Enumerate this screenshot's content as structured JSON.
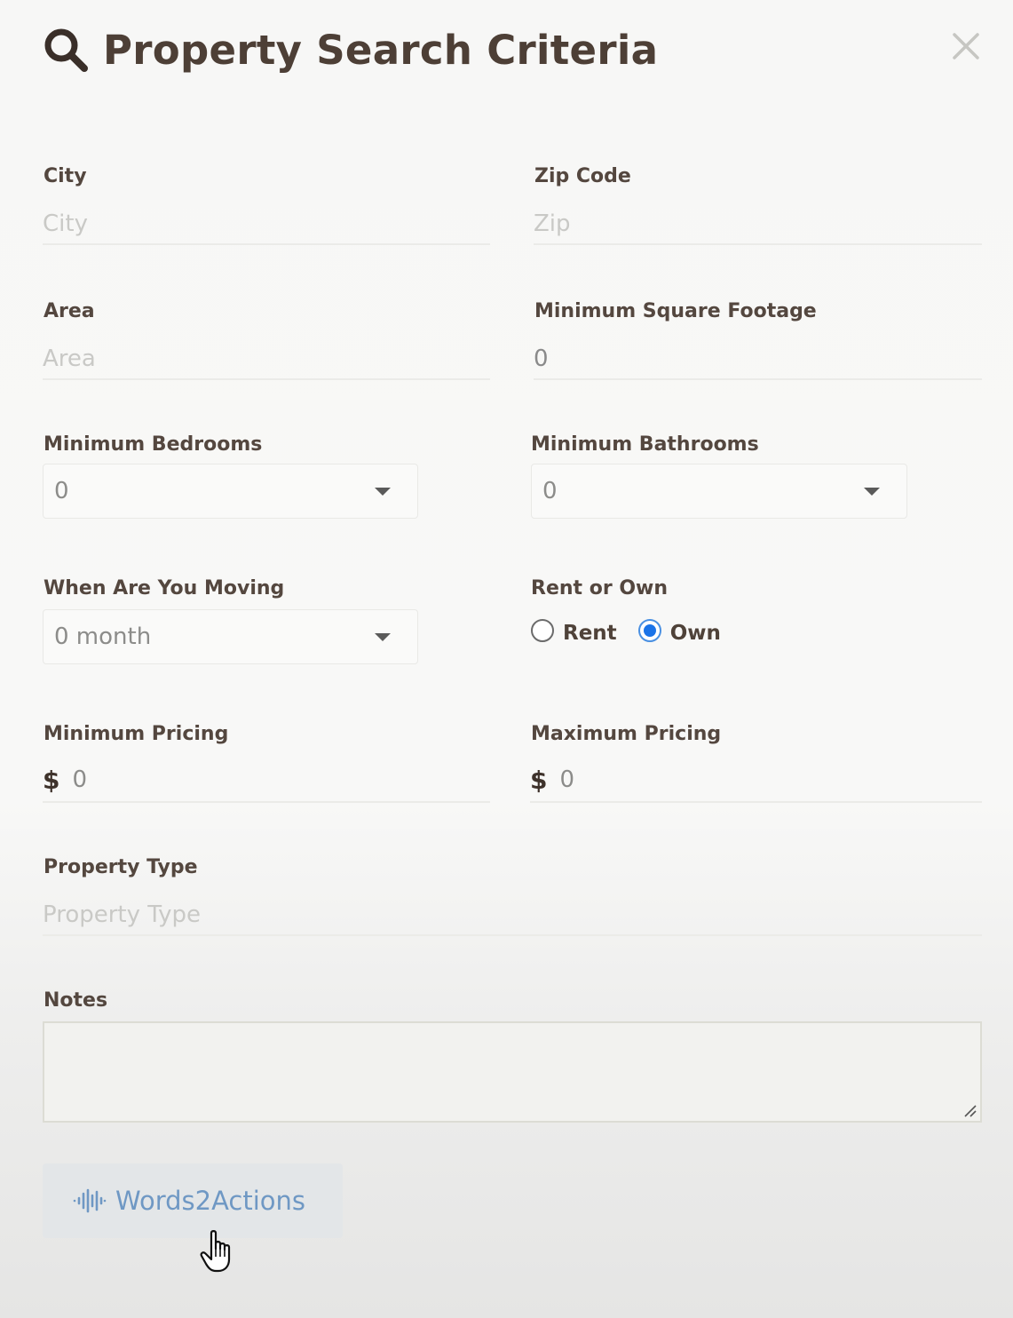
{
  "modal": {
    "title": "Property Search Criteria",
    "title_icon": "search-icon",
    "close_icon": "close-icon"
  },
  "fields": {
    "city": {
      "label": "City",
      "placeholder": "City",
      "value": ""
    },
    "zip": {
      "label": "Zip Code",
      "placeholder": "Zip",
      "value": ""
    },
    "area": {
      "label": "Area",
      "placeholder": "Area",
      "value": ""
    },
    "min_sqft": {
      "label": "Minimum Square Footage",
      "value": "0"
    },
    "min_bedrooms": {
      "label": "Minimum Bedrooms",
      "selected": "0"
    },
    "min_bathrooms": {
      "label": "Minimum Bathrooms",
      "selected": "0"
    },
    "moving": {
      "label": "When Are You Moving",
      "selected": "0 month"
    },
    "rent_own": {
      "label": "Rent or Own",
      "options": [
        {
          "label": "Rent",
          "checked": false
        },
        {
          "label": "Own",
          "checked": true
        }
      ]
    },
    "min_price": {
      "label": "Minimum Pricing",
      "currency": "$",
      "value": "0"
    },
    "max_price": {
      "label": "Maximum Pricing",
      "currency": "$",
      "value": "0"
    },
    "property_type": {
      "label": "Property Type",
      "placeholder": "Property Type",
      "value": ""
    },
    "notes": {
      "label": "Notes",
      "value": ""
    }
  },
  "actions": {
    "words2actions": {
      "label": "Words2Actions",
      "icon": "audio-waveform-icon"
    }
  },
  "colors": {
    "title_text": "#4d3f36",
    "label_text": "#54473f",
    "radio_checked": "#1a73e8",
    "button_text": "#6f98c4",
    "button_bg": "#e3e6e8"
  }
}
